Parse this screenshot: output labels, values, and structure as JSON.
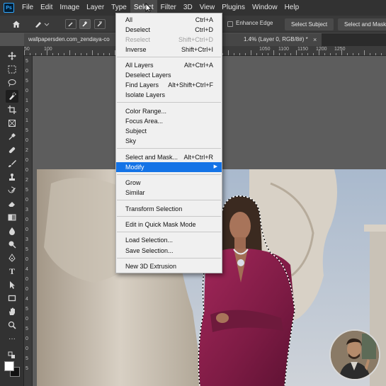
{
  "app": {
    "logo": "Ps",
    "menus": [
      "File",
      "Edit",
      "Image",
      "Layer",
      "Type",
      "Select",
      "Filter",
      "3D",
      "View",
      "Plugins",
      "Window",
      "Help"
    ],
    "active_menu": "Select"
  },
  "options_bar": {
    "enhance_edge_label": "Enhance Edge",
    "select_subject_label": "Select Subject",
    "select_and_mask_label": "Select and Mask..."
  },
  "document": {
    "tab_title": "wallpapersden.com_zendaya-co",
    "tab_suffix": "1.4% (Layer 0, RGB/8#) *",
    "tab_close": "×"
  },
  "rulers": {
    "horizontal": [
      "50",
      "100",
      "1050",
      "1100",
      "1150",
      "1200",
      "1250"
    ],
    "vertical": [
      "5",
      "0",
      "5",
      "0",
      "1",
      "0",
      "1",
      "5",
      "0",
      "2",
      "0",
      "0",
      "2",
      "5",
      "0",
      "3",
      "0",
      "0",
      "3",
      "5",
      "0",
      "4",
      "0",
      "0",
      "4",
      "5",
      "0",
      "5",
      "0",
      "0",
      "5",
      "5"
    ]
  },
  "select_menu": {
    "groups": [
      [
        {
          "label": "All",
          "shortcut": "Ctrl+A"
        },
        {
          "label": "Deselect",
          "shortcut": "Ctrl+D"
        },
        {
          "label": "Reselect",
          "shortcut": "Shift+Ctrl+D",
          "disabled": true
        },
        {
          "label": "Inverse",
          "shortcut": "Shift+Ctrl+I"
        }
      ],
      [
        {
          "label": "All Layers",
          "shortcut": "Alt+Ctrl+A"
        },
        {
          "label": "Deselect Layers",
          "shortcut": ""
        },
        {
          "label": "Find Layers",
          "shortcut": "Alt+Shift+Ctrl+F"
        },
        {
          "label": "Isolate Layers",
          "shortcut": ""
        }
      ],
      [
        {
          "label": "Color Range...",
          "shortcut": ""
        },
        {
          "label": "Focus Area...",
          "shortcut": ""
        },
        {
          "label": "Subject",
          "shortcut": ""
        },
        {
          "label": "Sky",
          "shortcut": ""
        }
      ],
      [
        {
          "label": "Select and Mask...",
          "shortcut": "Alt+Ctrl+R"
        },
        {
          "label": "Modify",
          "shortcut": "",
          "submenu": true,
          "highlighted": true
        }
      ],
      [
        {
          "label": "Grow",
          "shortcut": ""
        },
        {
          "label": "Similar",
          "shortcut": ""
        }
      ],
      [
        {
          "label": "Transform Selection",
          "shortcut": ""
        }
      ],
      [
        {
          "label": "Edit in Quick Mask Mode",
          "shortcut": ""
        }
      ],
      [
        {
          "label": "Load Selection...",
          "shortcut": ""
        },
        {
          "label": "Save Selection...",
          "shortcut": ""
        }
      ],
      [
        {
          "label": "New 3D Extrusion",
          "shortcut": ""
        }
      ]
    ]
  },
  "colors": {
    "menubar_bg": "#323232",
    "menu_highlight": "#1473e6",
    "dress": "#8a1f4a"
  },
  "toolbar": {
    "tools": [
      "move-icon",
      "marquee-icon",
      "lasso-icon",
      "quick-selection-icon",
      "crop-icon",
      "frame-icon",
      "eyedropper-icon",
      "healing-brush-icon",
      "brush-icon",
      "clone-stamp-icon",
      "history-brush-icon",
      "eraser-icon",
      "gradient-icon",
      "blur-icon",
      "dodge-icon",
      "pen-icon",
      "type-icon",
      "path-selection-icon",
      "rectangle-icon",
      "hand-icon",
      "zoom-icon"
    ]
  }
}
